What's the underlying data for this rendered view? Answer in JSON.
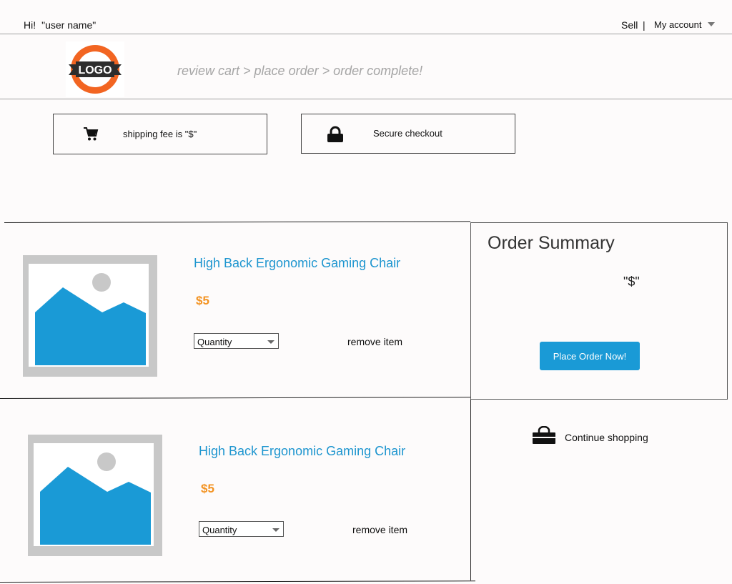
{
  "topbar": {
    "greeting": "Hi!",
    "user_name": "\"user name\"",
    "sell_label": "Sell",
    "separator": "|",
    "account_label": "My account"
  },
  "header": {
    "logo_text": "LOGO",
    "steps": "review cart > place order > order complete!"
  },
  "info": {
    "shipping_text": "shipping fee is \"$\"",
    "secure_text": "Secure checkout"
  },
  "cart": {
    "items": [
      {
        "name": "High Back Ergonomic Gaming Chair",
        "price": "$5",
        "quantity_label": "Quantity",
        "remove_label": "remove item"
      },
      {
        "name": "High Back Ergonomic Gaming Chair",
        "price": "$5",
        "quantity_label": "Quantity",
        "remove_label": "remove item"
      }
    ]
  },
  "summary": {
    "title": "Order Summary",
    "total": "\"$\"",
    "place_order_label": "Place Order Now!"
  },
  "continue_label": "Continue shopping",
  "colors": {
    "accent": "#1a9ad6",
    "price": "#f39322",
    "steps_text": "#a5a5a5",
    "placeholder_bg": "#c8c8c8",
    "logo_orange": "#f26522"
  },
  "icons": [
    "shopping-cart-icon",
    "lock-icon",
    "shopping-bag-icon",
    "chevron-down-icon",
    "image-placeholder-icon"
  ]
}
